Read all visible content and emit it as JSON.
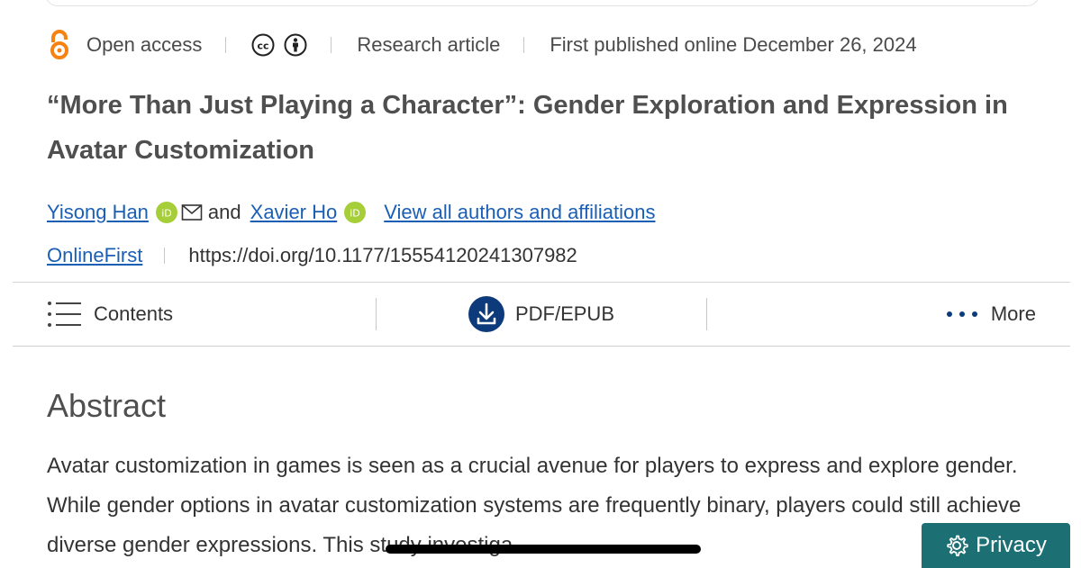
{
  "meta": {
    "open_access": "Open access",
    "article_type": "Research article",
    "published": "First published online December 26, 2024"
  },
  "article": {
    "title": "“More Than Just Playing a Character”: Gender Exploration and Expression in Avatar Customization",
    "author1": "Yisong Han",
    "and": "and",
    "author2": "Xavier Ho",
    "view_all": "View all authors and affiliations",
    "online_first": "OnlineFirst",
    "doi": "https://doi.org/10.1177/15554120241307982"
  },
  "toolbar": {
    "contents": "Contents",
    "pdf": "PDF/EPUB",
    "more": "More"
  },
  "abstract": {
    "heading": "Abstract",
    "text": "Avatar customization in games is seen as a crucial avenue for players to express and explore gender. While gender options in avatar customization systems are frequently binary, players could still achieve diverse gender expressions. This study investiga"
  },
  "privacy": {
    "label": "Privacy"
  },
  "icons": {
    "open_access": "open-access-icon",
    "cc": "cc-icon",
    "by": "attribution-icon",
    "orcid": "orcid-icon",
    "mail": "mail-icon",
    "contents": "hamburger-icon",
    "pdf": "download-icon",
    "more": "more-dots-icon",
    "privacy": "gear-icon"
  },
  "colors": {
    "link": "#1a5fb4",
    "orcid": "#a6ce39",
    "open_access": "#f68212",
    "pdf_button": "#0c3a7a",
    "privacy_bg": "#1c6f73"
  }
}
